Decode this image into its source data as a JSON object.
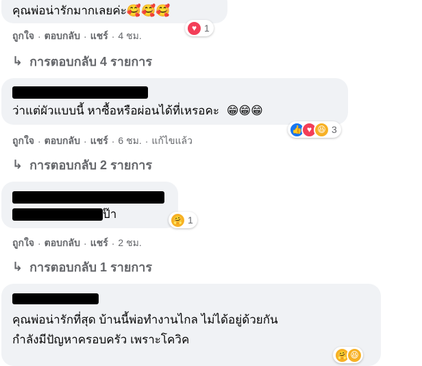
{
  "comments": [
    {
      "text": "คุณพ่อน่ารักมากเลยค่ะ",
      "emoji": "🥰🥰🥰",
      "actions": {
        "like": "ถูกใจ",
        "reply": "ตอบกลับ",
        "share": "แชร์",
        "time": "4 ชม."
      },
      "reaction_count": "1",
      "replies_label": "การตอบกลับ 4 รายการ"
    },
    {
      "text": "ว่าแต่ผัวแบบนี้ หาซื้อหรือผ่อนได้ที่เหรอคะ",
      "emoji": "😁😁😁",
      "actions": {
        "like": "ถูกใจ",
        "reply": "ตอบกลับ",
        "share": "แชร์",
        "time": "6 ชม.",
        "edited": "แก้ไขแล้ว"
      },
      "reaction_count": "3",
      "replies_label": "การตอบกลับ 2 รายการ"
    },
    {
      "text": "ป๊า",
      "actions": {
        "like": "ถูกใจ",
        "reply": "ตอบกลับ",
        "share": "แชร์",
        "time": "2 ชม."
      },
      "reaction_count": "1",
      "replies_label": "การตอบกลับ 1 รายการ"
    },
    {
      "line1": "คุณพ่อน่ารักที่สุด บ้านนี้พ่อทำงานไกล ไม่ได้อยู่ด้วยกัน",
      "line2": "กำลังมีปัญหาครอบครัว เพราะโควิค"
    }
  ],
  "separator": "·",
  "reply_arrow": "↳",
  "colors": {
    "bubble": "#f0f2f5",
    "meta": "#65676b",
    "like": "#1877f2",
    "love": "#f33e58",
    "care": "#f7b125"
  }
}
